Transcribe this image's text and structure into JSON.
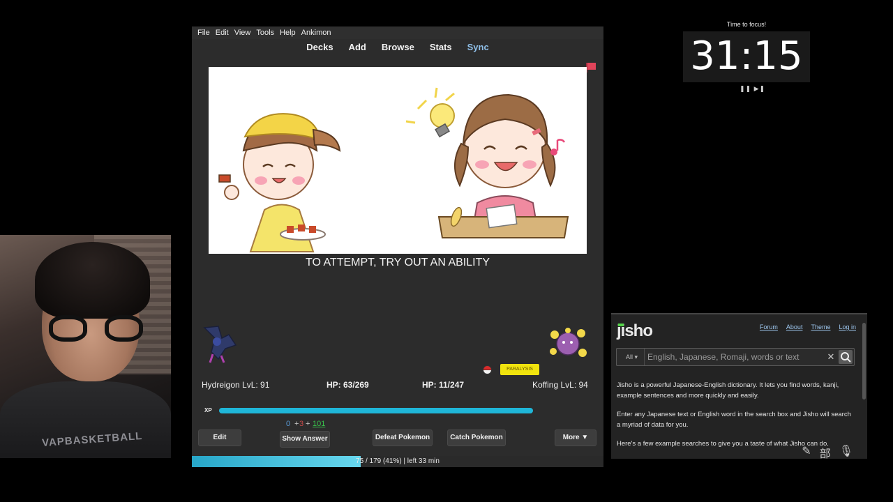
{
  "anki": {
    "menu": [
      "File",
      "Edit",
      "View",
      "Tools",
      "Help",
      "Ankimon"
    ],
    "toolbar": {
      "decks": "Decks",
      "add": "Add",
      "browse": "Browse",
      "stats": "Stats",
      "sync": "Sync"
    },
    "card_text": "TO ATTEMPT, TRY OUT AN ABILITY",
    "battle": {
      "player_name": "Hydreigon LvL: 91",
      "player_hp": "HP: 63/269",
      "enemy_hp": "HP: 11/247",
      "enemy_name": "Koffing LvL: 94",
      "enemy_status": "PARALYSIS",
      "xp_label": "XP",
      "xp_fraction": 1.0
    },
    "counts": {
      "new": "0",
      "plus1": "+",
      "learn": "3",
      "plus2": "+",
      "review": "101"
    },
    "buttons": {
      "edit": "Edit",
      "show_answer": "Show Answer",
      "defeat": "Defeat Pokemon",
      "catch": "Catch Pokemon",
      "more": "More ▼"
    },
    "progress": {
      "text": "75 / 179 (41%) | left 33 min",
      "fraction": 0.41
    }
  },
  "timer": {
    "title": "Time to focus!",
    "value": "31:15",
    "controls": "❚❚ ▶❚"
  },
  "jisho": {
    "logo": "jisho",
    "nav": [
      "Forum",
      "About",
      "Theme",
      "Log in"
    ],
    "search": {
      "select_value": "All ▾",
      "placeholder": "English, Japanese, Romaji, words or text",
      "clear": "✕"
    },
    "body": [
      "Jisho is a powerful Japanese-English dictionary. It lets you find words, kanji, example sentences and more quickly and easily.",
      "Enter any Japanese text or English word in the search box and Jisho will search a myriad of data for you.",
      "Here's a few example searches to give you a taste of what Jisho can do."
    ],
    "tools": [
      "✎",
      "部",
      "🎙"
    ]
  },
  "webcam": {
    "shirt_text": "VAPBASKETBALL"
  },
  "colors": {
    "accent_sync": "#8fbfe8",
    "xp_bar": "#1fb6d8",
    "status_paralysis": "#f0e30e",
    "review_count": "#38c14b",
    "learn_count": "#c84a4a",
    "new_count": "#5a9bd8"
  }
}
